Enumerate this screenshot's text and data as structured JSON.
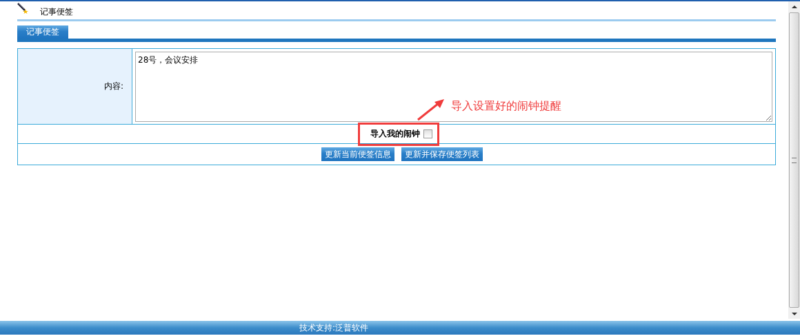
{
  "header": {
    "title": "记事便签"
  },
  "tabs": [
    {
      "label": "记事便签",
      "selected": true
    }
  ],
  "form": {
    "content_label": "内容:",
    "content_value": "28号，会议安排",
    "alarm_label": "导入我的闹钟",
    "alarm_checked": false,
    "buttons": [
      "更新当前便签信息",
      "更新并保存便签列表"
    ]
  },
  "annotation": {
    "text": "导入设置好的闹钟提醒"
  },
  "footer": {
    "text": "技术支持:泛普软件"
  }
}
